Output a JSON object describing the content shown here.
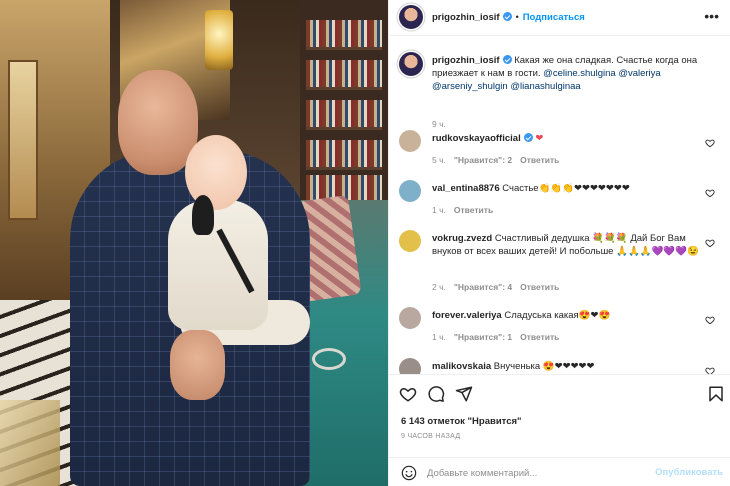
{
  "post": {
    "username": "prigozhin_iosif",
    "follow_label": "Подписаться",
    "more_label": "•••"
  },
  "caption": {
    "username": "prigozhin_iosif",
    "text": "Какая же она сладкая. Счастье когда она приезжает к нам в гости.",
    "mentions": [
      "@celine.shulgina",
      "@valeriya",
      "@arseniy_shulgin",
      "@lianashulginaa"
    ],
    "time": "9 ч."
  },
  "comments": [
    {
      "username": "rudkovskayaofficial",
      "verified": true,
      "text": "❤",
      "time": "5 ч.",
      "likes": "\"Нравится\": 2",
      "reply": "Ответить",
      "avatar_color": "#c9b29a"
    },
    {
      "username": "val_entina8876",
      "verified": false,
      "text": "Счастье👏👏👏❤❤❤❤❤❤❤",
      "time": "1 ч.",
      "likes": "",
      "reply": "Ответить",
      "avatar_color": "#7fb0c9"
    },
    {
      "username": "vokrug.zvezd",
      "verified": false,
      "text": "Счастливый дедушка 💐💐💐 Дай Бог Вам внуков от всех ваших детей! И побольше 🙏🙏🙏💜💜💜😉",
      "time": "2 ч.",
      "likes": "\"Нравится\": 4",
      "reply": "Ответить",
      "avatar_color": "#e2c04a"
    },
    {
      "username": "forever.valeriya",
      "verified": false,
      "text": "Сладуська какая😍❤😍",
      "time": "1 ч.",
      "likes": "\"Нравится\": 1",
      "reply": "Ответить",
      "avatar_color": "#b8a8a0"
    },
    {
      "username": "malikovskaia",
      "verified": false,
      "text": "Внученька 😍❤❤❤❤❤",
      "time": "",
      "likes": "",
      "reply": "",
      "avatar_color": "#9a8f88"
    }
  ],
  "stats": {
    "likes": "6 143 отметок \"Нравится\"",
    "ago": "9 ЧАСОВ НАЗАД"
  },
  "add_comment": {
    "placeholder": "Добавьте комментарий...",
    "publish_label": "Опубликовать"
  },
  "colors": {
    "accent": "#0095f6",
    "verified": "#3897f0",
    "heart_red": "#ed4956",
    "mention": "#00376b",
    "muted": "#8e8e8e"
  },
  "icons": {
    "like": "heart-icon",
    "comment": "comment-icon",
    "share": "share-icon",
    "save": "bookmark-icon",
    "emoji": "smiley-icon",
    "more": "more-horizontal-icon"
  }
}
